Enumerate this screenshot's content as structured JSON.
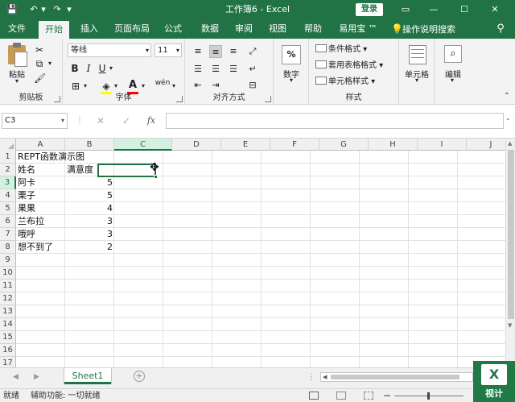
{
  "window": {
    "title": "工作簿6  -  Excel",
    "login_label": "登录",
    "icons": [
      "save-icon",
      "undo-icon",
      "redo-icon",
      "ribbon-display-icon",
      "minimize-icon",
      "maximize-icon",
      "close-icon"
    ],
    "accent_color": "#217346"
  },
  "tabs": [
    {
      "label": "文件"
    },
    {
      "label": "开始"
    },
    {
      "label": "插入"
    },
    {
      "label": "页面布局"
    },
    {
      "label": "公式"
    },
    {
      "label": "数据"
    },
    {
      "label": "审阅"
    },
    {
      "label": "视图"
    },
    {
      "label": "帮助"
    },
    {
      "label": "易用宝 ™"
    }
  ],
  "active_tab": "开始",
  "tell_me": "操作说明搜索",
  "ribbon": {
    "clipboard": {
      "paste_label": "粘贴",
      "group_label": "剪贴板"
    },
    "font": {
      "font_name": "等线",
      "font_size": "11",
      "group_label": "字体",
      "fill_color": "#ffff00",
      "font_color": "#ff0000",
      "bold": "B",
      "italic": "I",
      "underline": "U"
    },
    "alignment": {
      "group_label": "对齐方式"
    },
    "number": {
      "label": "数字",
      "percent": "%"
    },
    "styles": {
      "conditional": "条件格式",
      "table": "套用表格格式",
      "cell_styles": "单元格样式",
      "group_label": "样式"
    },
    "cells": {
      "label": "单元格"
    },
    "editing": {
      "label": "编辑"
    }
  },
  "formula_bar": {
    "name_box": "C3",
    "fx": "fx",
    "formula": ""
  },
  "grid": {
    "columns": [
      "A",
      "B",
      "C",
      "D",
      "E",
      "F",
      "G",
      "H",
      "I",
      "J"
    ],
    "rows": [
      "1",
      "2",
      "3",
      "4",
      "5",
      "6",
      "7",
      "8",
      "9",
      "10",
      "11",
      "12",
      "13",
      "14",
      "15",
      "16",
      "17"
    ],
    "selected_cell": "C3",
    "cells": {
      "A1": "REPT函数演示图",
      "A2": "姓名",
      "B2": "满意度",
      "A3": "阿卡",
      "B3": "5",
      "A4": "栗子",
      "B4": "5",
      "A5": "果果",
      "B5": "4",
      "A6": "兰布拉",
      "B6": "3",
      "A7": "哦呼",
      "B7": "3",
      "A8": "想不到了",
      "B8": "2"
    }
  },
  "sheet_tabs": [
    "Sheet1"
  ],
  "status": {
    "ready": "就绪",
    "accessibility": "辅助功能: 一切就绪"
  },
  "watermark": {
    "logo": "X",
    "text": "视计"
  }
}
